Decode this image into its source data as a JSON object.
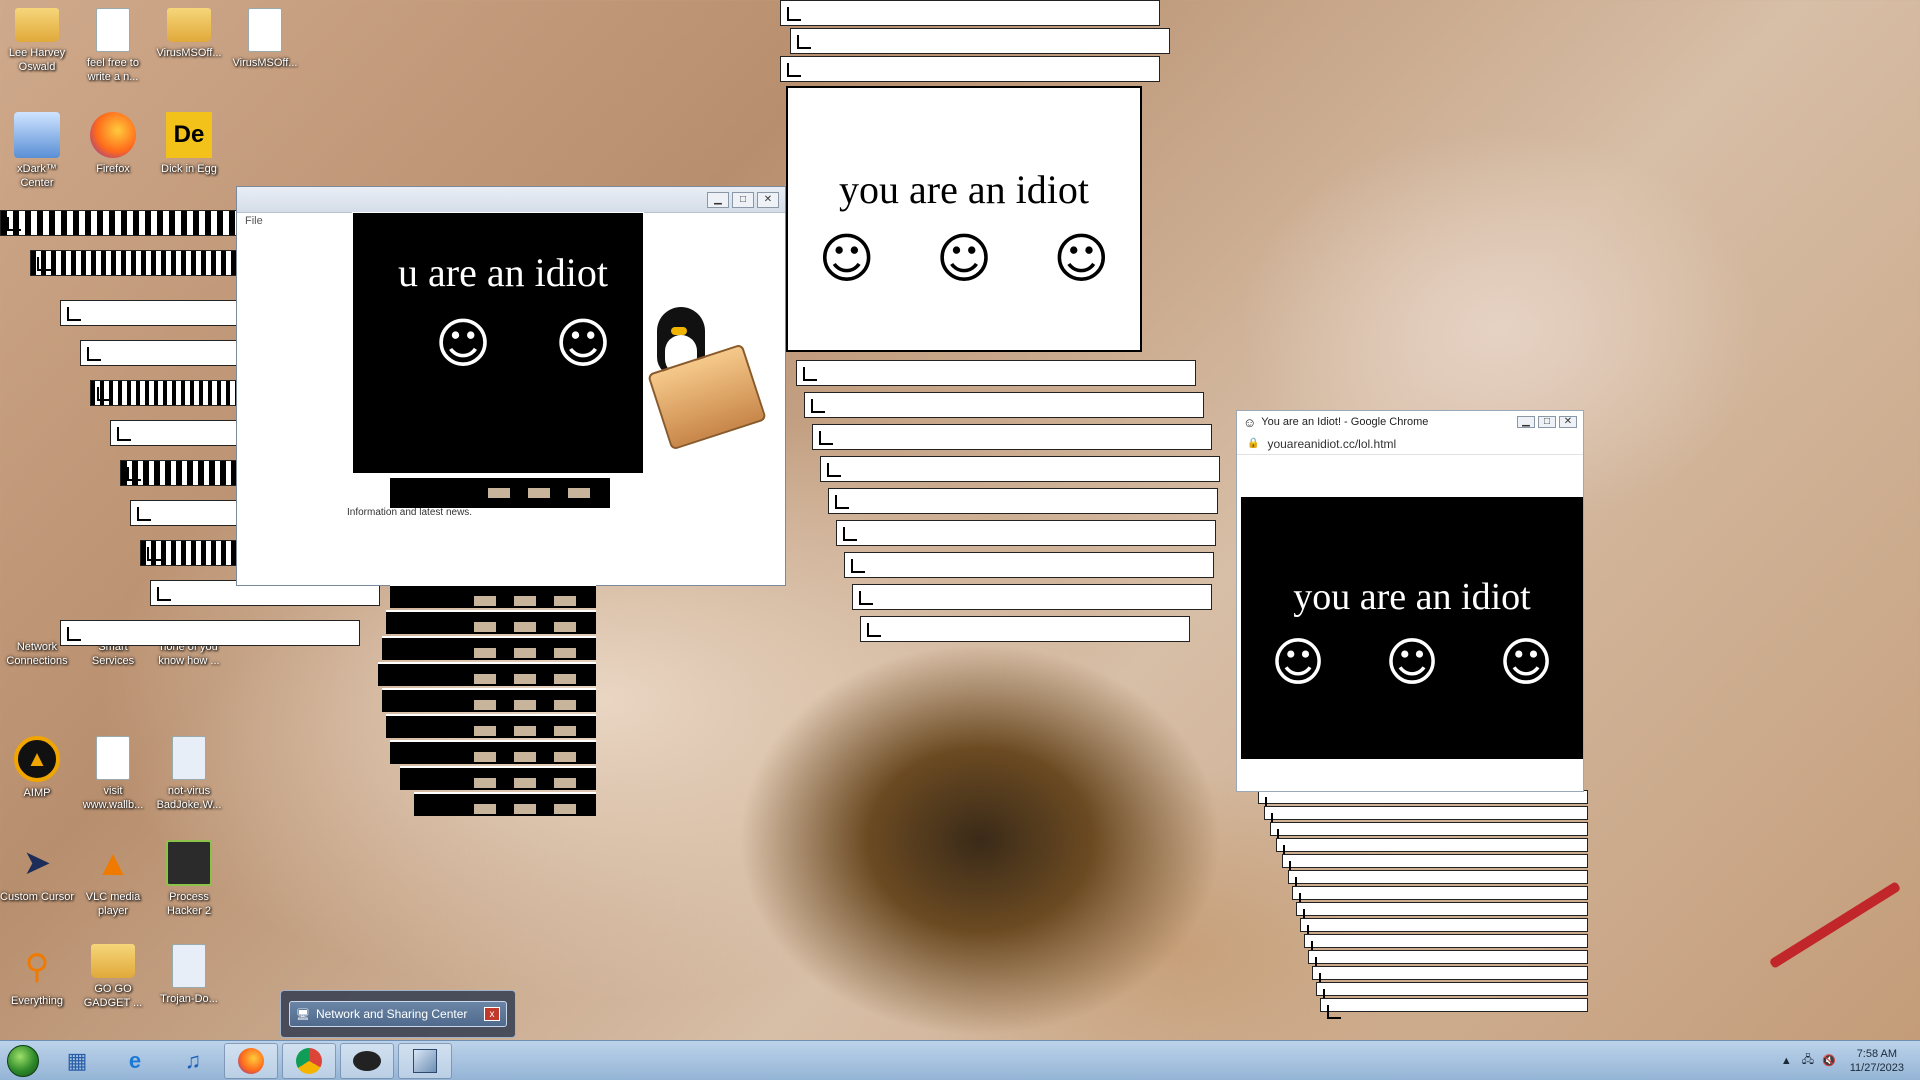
{
  "desktop_icons": [
    {
      "label": "Lee Harvey Oswald",
      "icon": "folder-icon"
    },
    {
      "label": "feel free to write a n...",
      "icon": "document-icon"
    },
    {
      "label": "VirusMSOff...",
      "icon": "folder-icon"
    },
    {
      "label": "VirusMSOff...",
      "icon": "document-icon"
    },
    {
      "label": "xDark™ Center",
      "icon": "computer-icon"
    },
    {
      "label": "Firefox",
      "icon": "firefox-icon"
    },
    {
      "label": "Dick in Egg",
      "icon": "app-icon"
    },
    {
      "label": "Network Connections",
      "icon": "network-icon"
    },
    {
      "label": "Smart Services",
      "icon": "services-icon"
    },
    {
      "label": "none of you know how ...",
      "icon": "document-icon"
    },
    {
      "label": "AIMP",
      "icon": "aimp-icon"
    },
    {
      "label": "visit www.wallb...",
      "icon": "document-icon"
    },
    {
      "label": "not-virus BadJoke.W...",
      "icon": "app-icon"
    },
    {
      "label": "Custom Cursor",
      "icon": "cursor-icon"
    },
    {
      "label": "VLC media player",
      "icon": "vlc-icon"
    },
    {
      "label": "Process Hacker 2",
      "icon": "app-icon"
    },
    {
      "label": "Everything",
      "icon": "search-icon"
    },
    {
      "label": "GO GO GADGET ...",
      "icon": "folder-icon"
    },
    {
      "label": "Trojan-Do...",
      "icon": "app-icon"
    }
  ],
  "idiot": {
    "text": "you are an idiot",
    "text_partial": "u are an idiot",
    "smiley": "☺"
  },
  "chrome_window": {
    "title": "You are an Idiot! - Google Chrome",
    "url": "youareanidiot.cc/lol.html"
  },
  "background_window": {
    "menu_file": "File",
    "news_text": "Information and latest news."
  },
  "tooltip": {
    "label": "Network and Sharing Center",
    "close": "x"
  },
  "taskbar": {
    "apps": [
      "explorer",
      "internet-explorer",
      "itunes",
      "firefox",
      "chrome",
      "shell",
      "box"
    ]
  },
  "clock": {
    "time": "7:58 AM",
    "date": "11/27/2023"
  }
}
